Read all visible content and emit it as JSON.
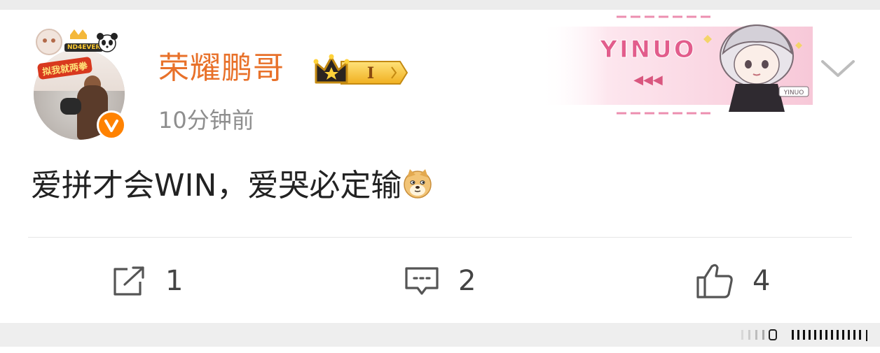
{
  "post": {
    "username": "荣耀鹏哥",
    "vip_level": "I",
    "timestamp": "10分钟前",
    "content": "爱拼才会WIN，爱哭必定输",
    "content_emoji": "doge-emoji"
  },
  "card_decoration": {
    "text": "YINUO",
    "arrows": "◀◀◀",
    "mini_label": "YINUO"
  },
  "avatar_frame": {
    "banner_text": "拟我就两拳",
    "sub_text": "ND4EVER"
  },
  "actions": {
    "share_count": "1",
    "comment_count": "2",
    "like_count": "4"
  },
  "colors": {
    "username": "#e8712a",
    "verified_badge": "#ff8200",
    "vip_gold": "#f6c43a",
    "deco_pink": "#e8799b"
  }
}
